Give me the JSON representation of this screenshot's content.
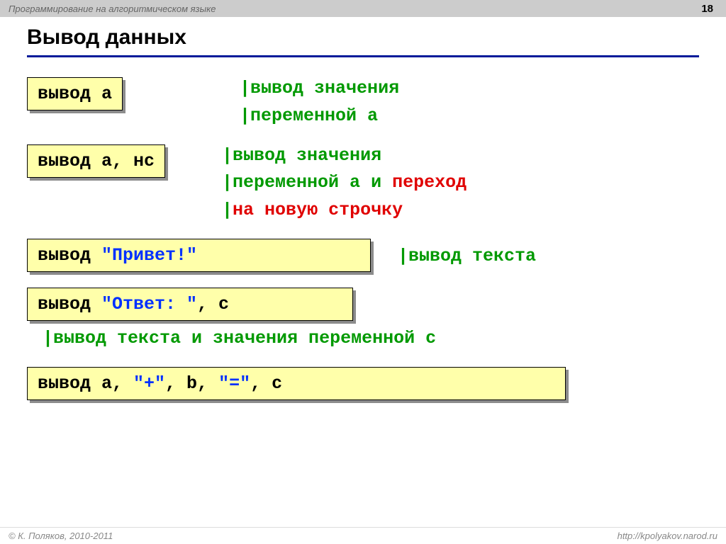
{
  "header": {
    "title": "Программирование на алгоритмическом языке",
    "page": "18"
  },
  "slideTitle": "Вывод данных",
  "rows": {
    "r1": {
      "code": "вывод a",
      "comment_g1": "|вывод значения",
      "comment_g2": "|переменной a"
    },
    "r2": {
      "code": "вывод a, нс",
      "comment_g1": "|вывод значения",
      "comment_g2_a": "|переменной a и ",
      "comment_r2_b": "переход",
      "comment_g3_a": "|",
      "comment_r3_b": "на новую строчку"
    },
    "r3": {
      "code_kw": "вывод ",
      "code_str": "\"Привет!\"",
      "comment": "|вывод текста"
    },
    "r4": {
      "code_kw": "вывод ",
      "code_str": "\"Ответ: \"",
      "code_rest": ", c",
      "comment": "|вывод текста и значения переменной c"
    },
    "r5": {
      "code_kw": "вывод ",
      "p1": "a, ",
      "s1": "\"+\"",
      "p2": ", b, ",
      "s2": "\"=\"",
      "p3": ", c"
    }
  },
  "footer": {
    "left": "© К. Поляков, 2010-2011",
    "right": "http://kpolyakov.narod.ru"
  }
}
